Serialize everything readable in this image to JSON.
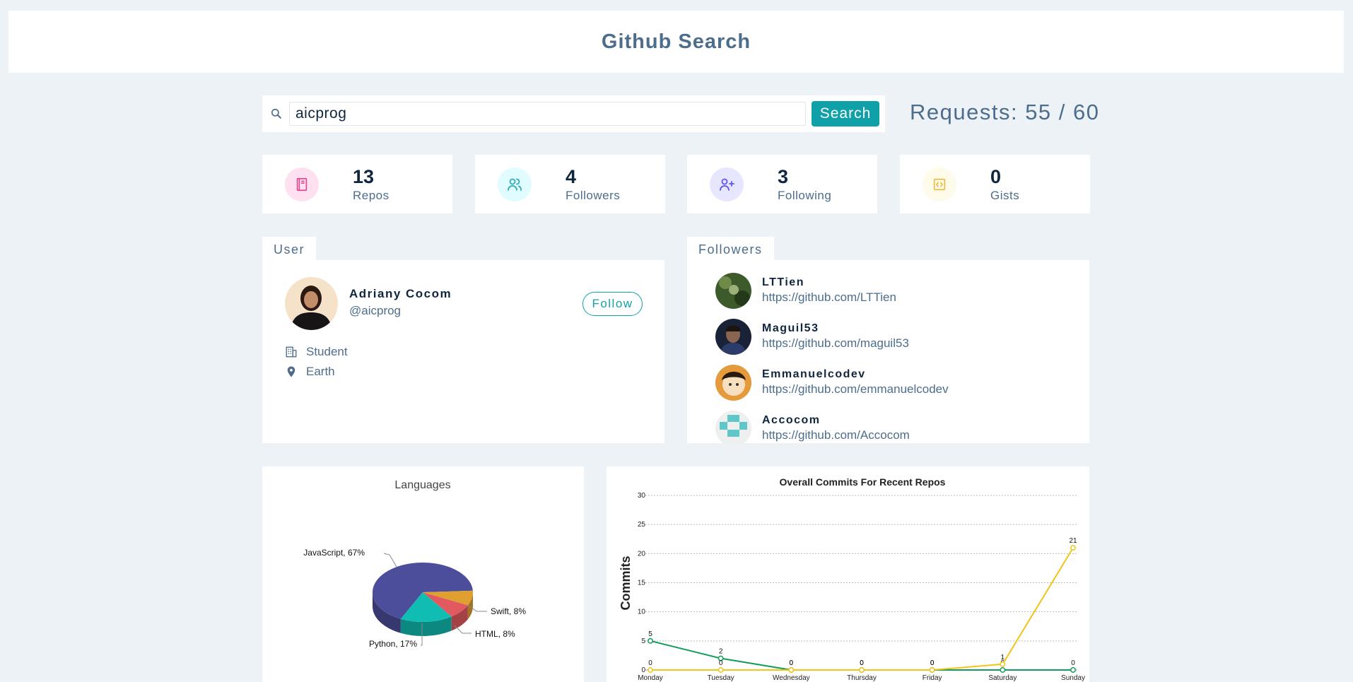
{
  "header": {
    "title": "Github Search"
  },
  "search": {
    "value": "aicprog",
    "button_label": "Search"
  },
  "requests": {
    "text": "Requests: 55 / 60"
  },
  "stats": [
    {
      "value": "13",
      "label": "Repos",
      "icon": "book-icon",
      "color": "#da4a91",
      "bg": "#ffe0f0"
    },
    {
      "value": "4",
      "label": "Followers",
      "icon": "users-icon",
      "color": "#2caeba",
      "bg": "#e0fcff"
    },
    {
      "value": "3",
      "label": "Following",
      "icon": "user-plus-icon",
      "color": "#5d55fa",
      "bg": "#e6e6ff"
    },
    {
      "value": "0",
      "label": "Gists",
      "icon": "code-icon",
      "color": "#f0b429",
      "bg": "#fffbea"
    }
  ],
  "user": {
    "tab_label": "User",
    "name": "Adriany Cocom",
    "login": "@aicprog",
    "follow_label": "Follow",
    "company": "Student",
    "location": "Earth"
  },
  "followers": {
    "tab_label": "Followers",
    "items": [
      {
        "name": "LTTien",
        "url": "https://github.com/LTTien"
      },
      {
        "name": "Maguil53",
        "url": "https://github.com/maguil53"
      },
      {
        "name": "Emmanuelcodev",
        "url": "https://github.com/emmanuelcodev"
      },
      {
        "name": "Accocom",
        "url": "https://github.com/Accocom"
      }
    ]
  },
  "colors": {
    "accent": "#10a1a8",
    "muted": "#4d6d8c",
    "dark": "#10263f",
    "background": "#edf2f6"
  },
  "chart_data": [
    {
      "type": "pie",
      "title": "Languages",
      "slices": [
        {
          "label": "JavaScript, 67%",
          "name": "JavaScript",
          "value": 67,
          "color": "#4c4e9c"
        },
        {
          "label": "Python, 17%",
          "name": "Python",
          "value": 17,
          "color": "#10bdb3"
        },
        {
          "label": "HTML, 8%",
          "name": "HTML",
          "value": 8,
          "color": "#e25a5f"
        },
        {
          "label": "Swift, 8%",
          "name": "Swift",
          "value": 8,
          "color": "#e0a030"
        }
      ]
    },
    {
      "type": "line",
      "title": "Overall Commits For Recent Repos",
      "ylabel": "Commits",
      "xlabel": "",
      "categories": [
        "Monday",
        "Tuesday",
        "Wednesday",
        "Thursday",
        "Friday",
        "Saturday",
        "Sunday"
      ],
      "ylim": [
        0,
        30
      ],
      "yticks": [
        0,
        5,
        10,
        15,
        20,
        25,
        30
      ],
      "grid": true,
      "series": [
        {
          "values": [
            5,
            2,
            0,
            0,
            0,
            0,
            0
          ],
          "color": "#0f9d58"
        },
        {
          "values": [
            0,
            0,
            0,
            0,
            0,
            1,
            21
          ],
          "color": "#f2c318"
        }
      ]
    }
  ]
}
